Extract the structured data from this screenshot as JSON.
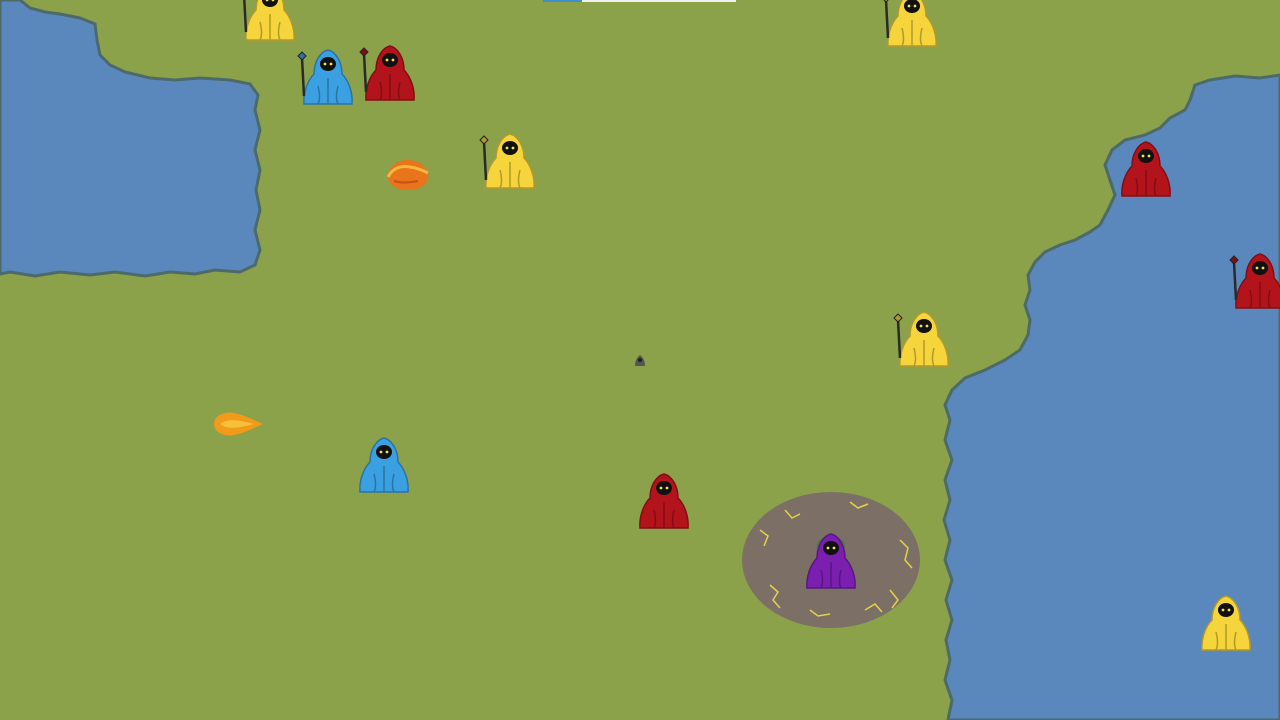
{
  "game": {
    "colors": {
      "grass": "#8ba24a",
      "water": "#5a88bd",
      "shore": "#4d6a6a",
      "team_yellow": "#f6d43c",
      "team_red": "#b3141c",
      "team_blue": "#3aa0e2",
      "player_purple": "#7b1fb0",
      "aoe_circle": "#7a6a68",
      "aoe_lightning": "#e6d24a",
      "fireball": "#f28a1a"
    },
    "hud": {
      "progress_fraction": 0.2
    },
    "units": [
      {
        "name": "wizard-yellow",
        "team": "yellow",
        "staff": true
      },
      {
        "name": "wizard-yellow",
        "team": "yellow",
        "staff": true
      },
      {
        "name": "wizard-blue",
        "team": "blue",
        "staff": true
      },
      {
        "name": "wizard-red",
        "team": "red",
        "staff": true
      },
      {
        "name": "wizard-yellow",
        "team": "yellow",
        "staff": true
      },
      {
        "name": "wizard-red",
        "team": "red",
        "staff": false
      },
      {
        "name": "wizard-red",
        "team": "red",
        "staff": true
      },
      {
        "name": "wizard-yellow",
        "team": "yellow",
        "staff": true
      },
      {
        "name": "wizard-blue",
        "team": "blue",
        "staff": false
      },
      {
        "name": "wizard-red",
        "team": "red",
        "staff": false
      },
      {
        "name": "wizard-purple-player",
        "team": "purple",
        "staff": false
      },
      {
        "name": "wizard-yellow",
        "team": "yellow",
        "staff": false
      }
    ],
    "projectiles": [
      {
        "name": "fireball-projectile",
        "kind": "fireball"
      },
      {
        "name": "fireball-projectile",
        "kind": "flame"
      }
    ],
    "effects": [
      {
        "name": "lightning-aoe-circle",
        "kind": "lightning-field"
      }
    ],
    "markers": [
      {
        "name": "target-marker-icon",
        "kind": "tiny-wizard"
      }
    ]
  }
}
